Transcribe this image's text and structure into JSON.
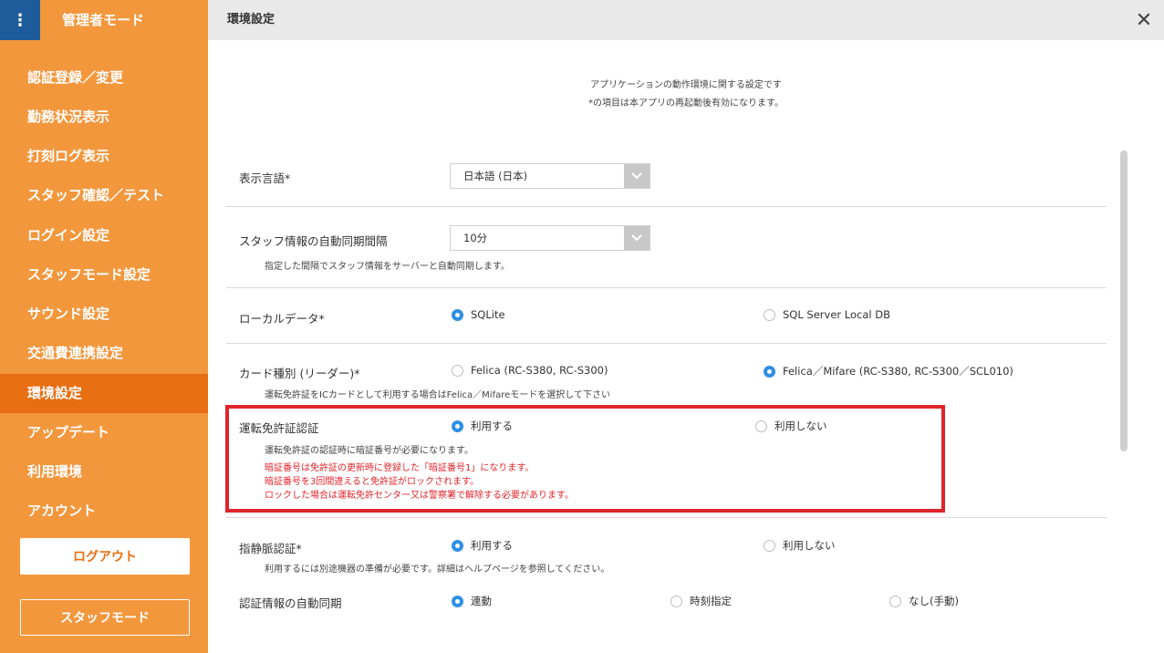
{
  "sidebar": {
    "title": "管理者モード",
    "menu_icon": "more-vertical-icon",
    "items": [
      {
        "label": "認証登録／変更"
      },
      {
        "label": "勤務状況表示"
      },
      {
        "label": "打刻ログ表示"
      },
      {
        "label": "スタッフ確認／テスト"
      },
      {
        "label": "ログイン設定"
      },
      {
        "label": "スタッフモード設定"
      },
      {
        "label": "サウンド設定"
      },
      {
        "label": "交通費連携設定"
      },
      {
        "label": "環境設定"
      },
      {
        "label": "アップデート"
      },
      {
        "label": "利用環境"
      },
      {
        "label": "アカウント"
      }
    ],
    "active_item": "環境設定",
    "logout_label": "ログアウト",
    "staff_mode_label": "スタッフモード"
  },
  "header": {
    "title": "環境設定",
    "close_icon": "close-icon"
  },
  "intro": {
    "line1": "アプリケーションの動作環境に関する設定です",
    "line2": "*の項目は本アプリの再起動後有効になります。"
  },
  "settings": {
    "language": {
      "label": "表示言語*",
      "value": "日本語 (日本)"
    },
    "sync_interval": {
      "label": "スタッフ情報の自動同期間隔",
      "value": "10分",
      "desc": "指定した間隔でスタッフ情報をサーバーと自動同期します。"
    },
    "local_data": {
      "label": "ローカルデータ*",
      "options": [
        "SQLite",
        "SQL Server Local DB"
      ],
      "selected": "SQLite"
    },
    "card_type": {
      "label": "カード種別 (リーダー)*",
      "options": [
        "Felica (RC-S380, RC-S300)",
        "Felica／Mifare (RC-S380, RC-S300／SCL010)"
      ],
      "selected": "Felica／Mifare (RC-S380, RC-S300／SCL010)",
      "desc": "運転免許証をICカードとして利用する場合はFelica／Mifareモードを選択して下さい"
    },
    "license_auth": {
      "label": "運転免許証認証",
      "options": [
        "利用する",
        "利用しない"
      ],
      "selected": "利用する",
      "desc": "運転免許証の認証時に暗証番号が必要になります。",
      "warnings": [
        "暗証番号は免許証の更新時に登録した「暗証番号1」になります。",
        "暗証番号を3回間違えると免許証がロックされます。",
        "ロックした場合は運転免許センター又は警察署で解除する必要があります。"
      ]
    },
    "vein_auth": {
      "label": "指静脈認証*",
      "options": [
        "利用する",
        "利用しない"
      ],
      "selected": "利用する",
      "desc": "利用するには別途機器の準備が必要です。詳細はヘルプページを参照してください。"
    },
    "auth_sync": {
      "label": "認証情報の自動同期",
      "options": [
        "連動",
        "時刻指定",
        "なし(手動)"
      ],
      "selected": "連動"
    }
  },
  "colors": {
    "sidebar": "#f3973d",
    "sidebar_active": "#e86e12",
    "menu_button": "#1e5b9b",
    "radio_accent": "#2f8fe3",
    "highlight": "#e0242b"
  }
}
